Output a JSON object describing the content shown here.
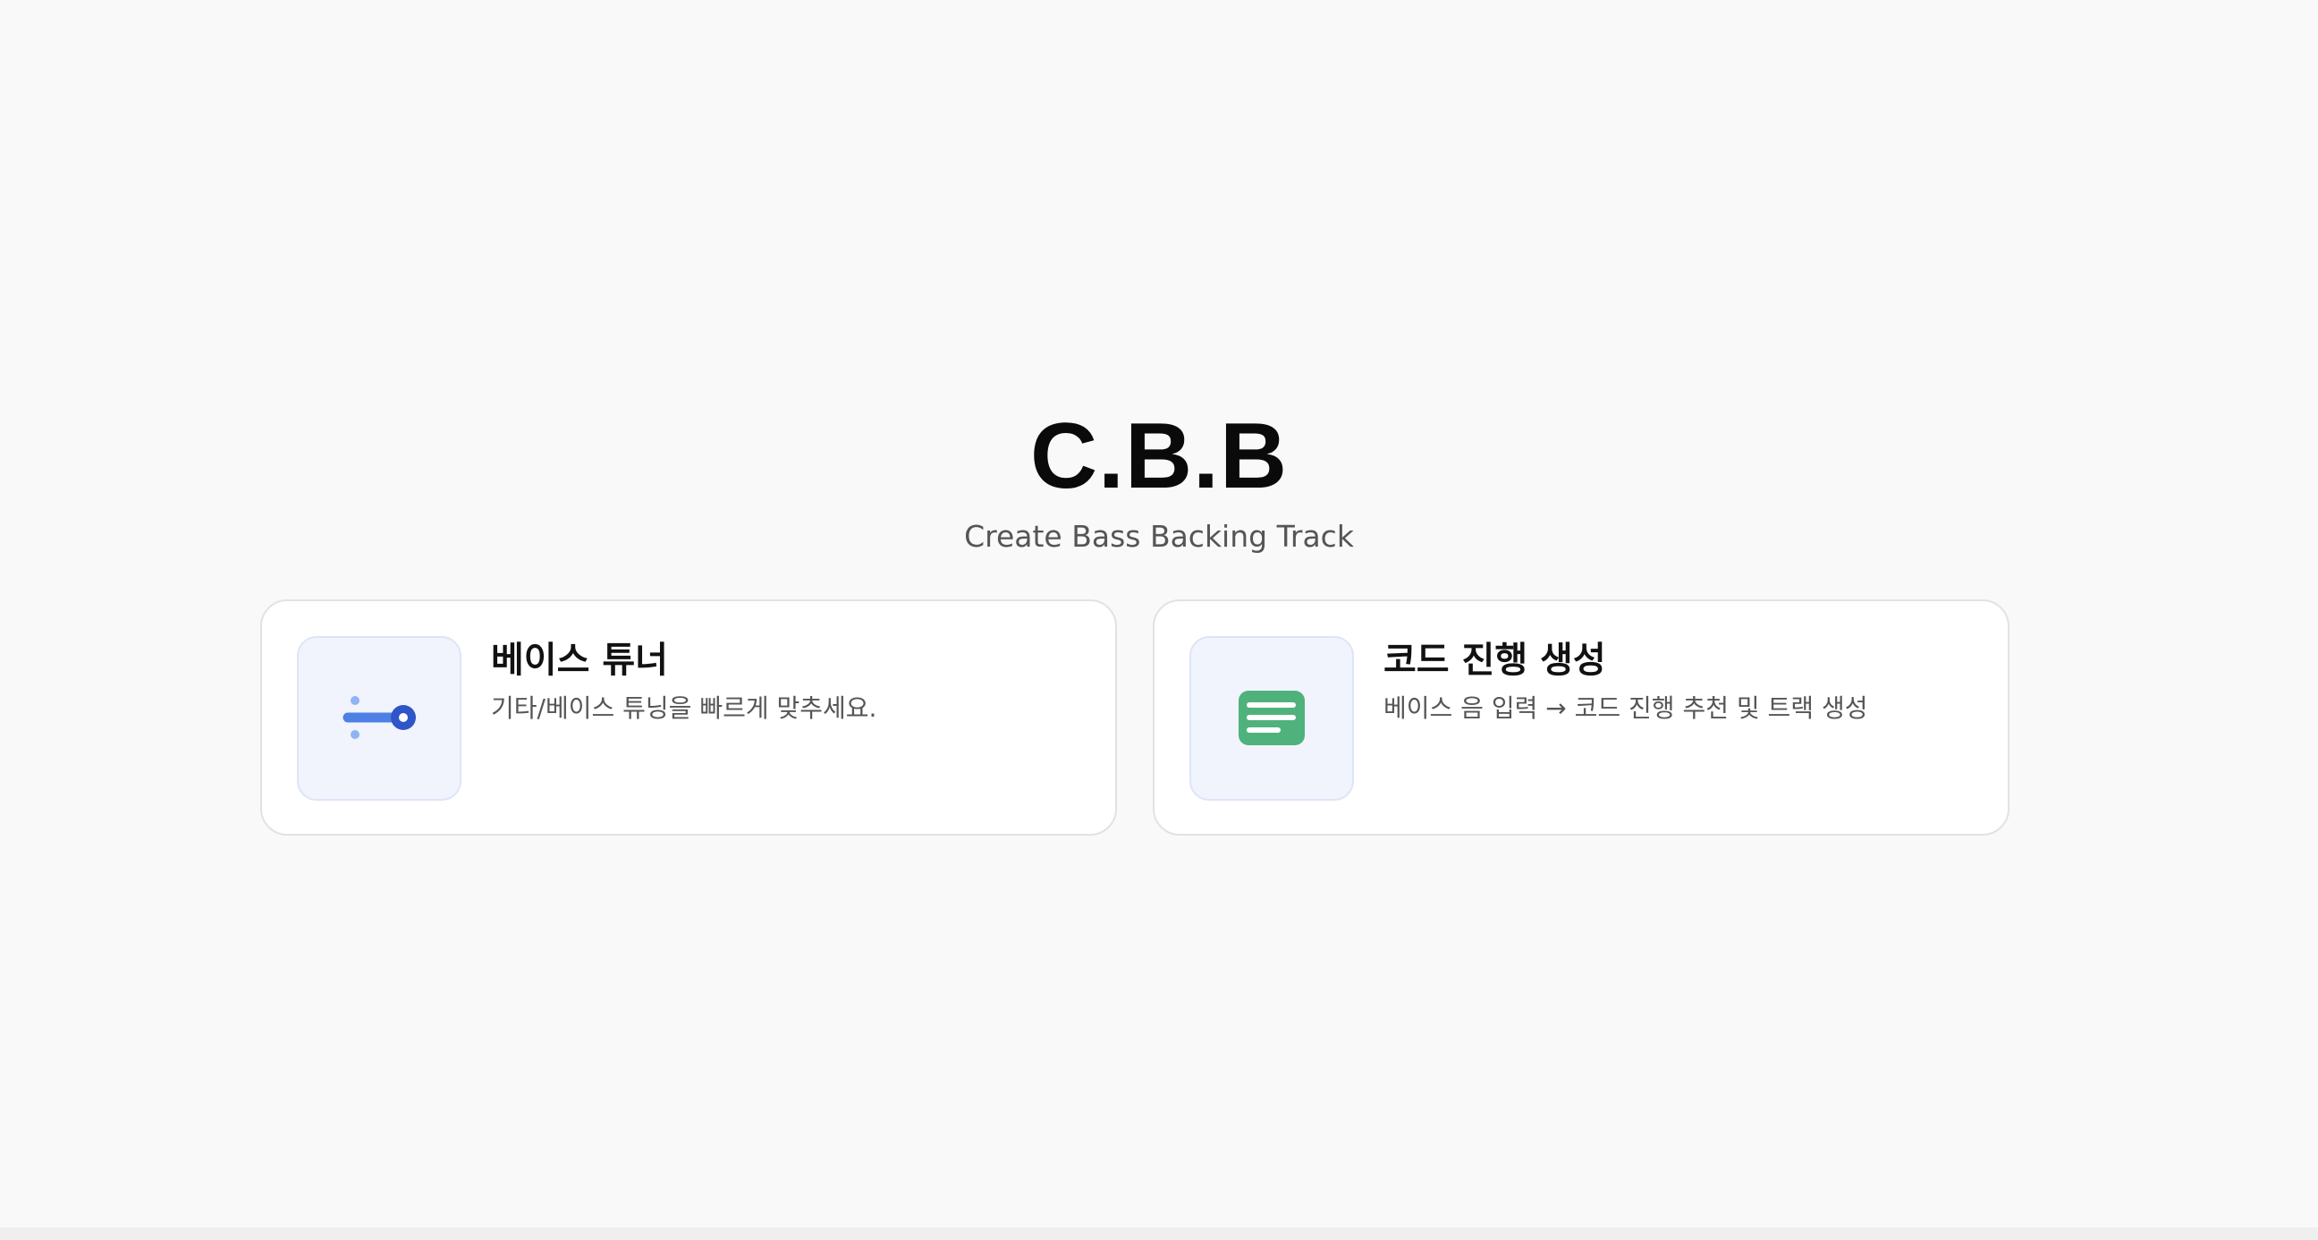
{
  "header": {
    "title": "C.B.B",
    "subtitle": "Create Bass Backing Track"
  },
  "cards": [
    {
      "title": "베이스 튜너",
      "description": "기타/베이스 튜닝을 빠르게 맞추세요.",
      "icon": "tuner-icon",
      "icon_colors": {
        "line": "#4e7fe4",
        "knob": "#2f56c8",
        "dots": "#8fb3f3"
      }
    },
    {
      "title": "코드 진행 생성",
      "description": "베이스 음 입력 → 코드 진행 추천 및 트랙 생성",
      "icon": "document-lines-icon",
      "icon_colors": {
        "fill": "#4fb27c",
        "lines": "#ffffff"
      }
    }
  ],
  "colors": {
    "background": "#f9f9f9",
    "card_background": "#ffffff",
    "card_border": "#e2e2e2",
    "icon_box_background": "#f1f4fd"
  }
}
